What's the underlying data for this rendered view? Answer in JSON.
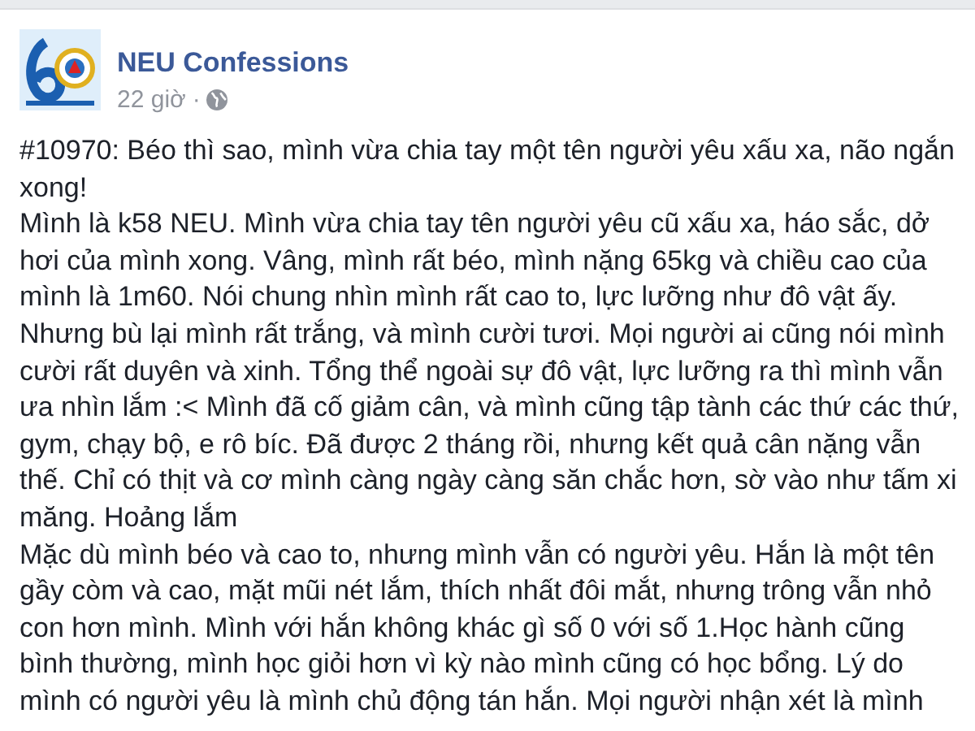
{
  "post": {
    "author": "NEU Confessions",
    "time": "22 giờ",
    "separator": "·",
    "paragraphs": [
      {
        "lines": [
          "#10970: Béo thì sao, mình vừa chia tay một tên người yêu xấu xa, não ngắn",
          "xong!"
        ]
      },
      {
        "lines": [
          "Mình là k58 NEU. Mình vừa chia tay tên người yêu cũ xấu xa, háo sắc, dở",
          "hơi của mình xong. Vâng, mình rất béo, mình nặng 65kg và chiều cao của",
          "mình là 1m60. Nói chung nhìn mình rất cao to, lực lưỡng như đô vật ấy.",
          "Nhưng bù lại mình rất trắng, và mình cười tươi. Mọi người ai cũng nói mình",
          "cười rất duyên và xinh. Tổng thể ngoài sự đô vật, lực lưỡng ra thì mình vẫn",
          "ưa nhìn lắm :< Mình đã cố giảm cân, và mình cũng tập tành các thứ các thứ,",
          "gym, chạy bộ, e rô bíc. Đã được 2 tháng rồi, nhưng kết quả cân nặng vẫn",
          "thế. Chỉ có thịt và cơ mình càng ngày càng săn chắc hơn, sờ vào như tấm xi",
          "măng. Hoảng lắm"
        ]
      },
      {
        "lines": [
          "Mặc dù mình béo và cao to, nhưng mình vẫn có người yêu. Hắn là một tên",
          "gầy còm và cao, mặt mũi nét lắm, thích nhất đôi mắt, nhưng trông vẫn nhỏ",
          "con hơn mình. Mình với hắn không khác gì số 0 với số 1.Học hành cũng",
          "bình thường, mình học giỏi hơn vì kỳ nào mình cũng có học bổng. Lý do",
          "mình có người yêu là mình chủ động tán hắn. Mọi người nhận xét là mình"
        ]
      }
    ]
  }
}
